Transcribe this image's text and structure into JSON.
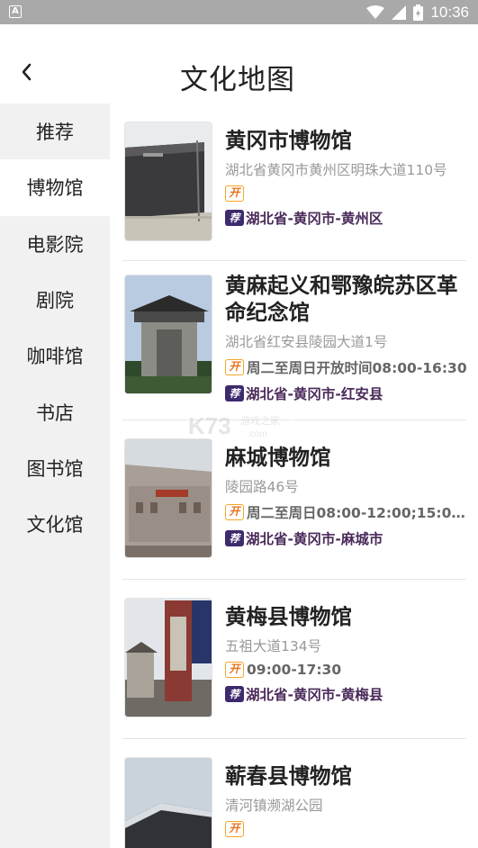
{
  "status_bar": {
    "badge": "A",
    "time": "10:36",
    "icons": [
      "wifi-icon",
      "signal-icon",
      "battery-icon"
    ]
  },
  "header": {
    "title": "文化地图",
    "back_icon": "chevron-left-icon"
  },
  "sidebar": {
    "items": [
      {
        "label": "推荐"
      },
      {
        "label": "博物馆",
        "active": true
      },
      {
        "label": "电影院"
      },
      {
        "label": "剧院"
      },
      {
        "label": "咖啡馆"
      },
      {
        "label": "书店"
      },
      {
        "label": "图书馆"
      },
      {
        "label": "文化馆"
      }
    ]
  },
  "list": {
    "open_badge": "开",
    "recommend_badge": "荐",
    "items": [
      {
        "name": "黄冈市博物馆",
        "address": "湖北省黄冈市黄州区明珠大道110号",
        "hours": "",
        "region": "湖北省-黄冈市-黄州区"
      },
      {
        "name": "黄麻起义和鄂豫皖苏区革命纪念馆",
        "address": "湖北省红安县陵园大道1号",
        "hours": "周二至周日开放时间08:00-16:30",
        "region": "湖北省-黄冈市-红安县"
      },
      {
        "name": "麻城博物馆",
        "address": "陵园路46号",
        "hours": "周二至周日08:00-12:00;15:00...",
        "region": "湖北省-黄冈市-麻城市"
      },
      {
        "name": "黄梅县博物馆",
        "address": "五祖大道134号",
        "hours": "09:00-17:30",
        "region": "湖北省-黄冈市-黄梅县"
      },
      {
        "name": "蕲春县博物馆",
        "address": "清河镇濒湖公园",
        "hours": "",
        "region": ""
      }
    ]
  },
  "watermark": {
    "brand": "K73",
    "text": "游戏之家",
    "url": ".com"
  }
}
